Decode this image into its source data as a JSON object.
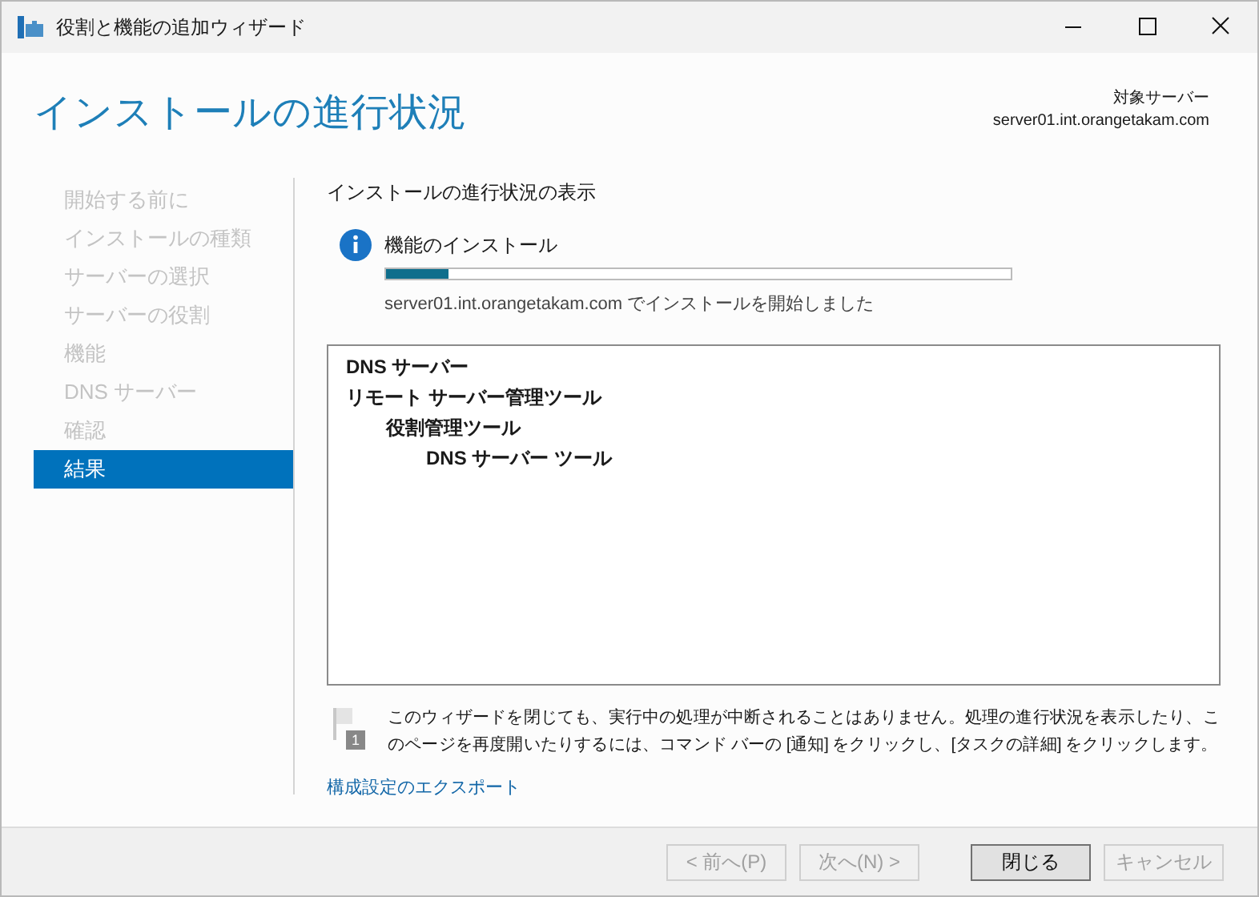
{
  "window": {
    "title": "役割と機能の追加ウィザード"
  },
  "page_title": "インストールの進行状況",
  "target_server": {
    "label": "対象サーバー",
    "value": "server01.int.orangetakam.com"
  },
  "sidebar": {
    "items": [
      {
        "label": "開始する前に",
        "selected": false,
        "disabled": true
      },
      {
        "label": "インストールの種類",
        "selected": false,
        "disabled": true
      },
      {
        "label": "サーバーの選択",
        "selected": false,
        "disabled": true
      },
      {
        "label": "サーバーの役割",
        "selected": false,
        "disabled": true
      },
      {
        "label": "機能",
        "selected": false,
        "disabled": true
      },
      {
        "label": "DNS サーバー",
        "selected": false,
        "disabled": true
      },
      {
        "label": "確認",
        "selected": false,
        "disabled": true
      },
      {
        "label": "結果",
        "selected": true,
        "disabled": false
      }
    ]
  },
  "section_title": "インストールの進行状況の表示",
  "status": {
    "label": "機能のインストール",
    "level": 0.1,
    "message": "server01.int.orangetakam.com でインストールを開始しました"
  },
  "results": [
    {
      "label": "DNS サーバー"
    },
    {
      "label": "リモート サーバー管理ツール",
      "children": [
        {
          "label": "役割管理ツール",
          "children": [
            {
              "label": "DNS サーバー ツール"
            }
          ]
        }
      ]
    }
  ],
  "note": {
    "badge": "1",
    "text": "このウィザードを閉じても、実行中の処理が中断されることはありません。処理の進行状況を表示したり、このページを再度開いたりするには、コマンド バーの [通知] をクリックし、[タスクの詳細] をクリックします。"
  },
  "export_link": "構成設定のエクスポート",
  "buttons": [
    {
      "label": "< 前へ(P)",
      "disabled": true
    },
    {
      "label": "次へ(N) >",
      "disabled": true
    },
    {
      "label": "閉じる",
      "disabled": false
    },
    {
      "label": "キャンセル",
      "disabled": true
    }
  ]
}
